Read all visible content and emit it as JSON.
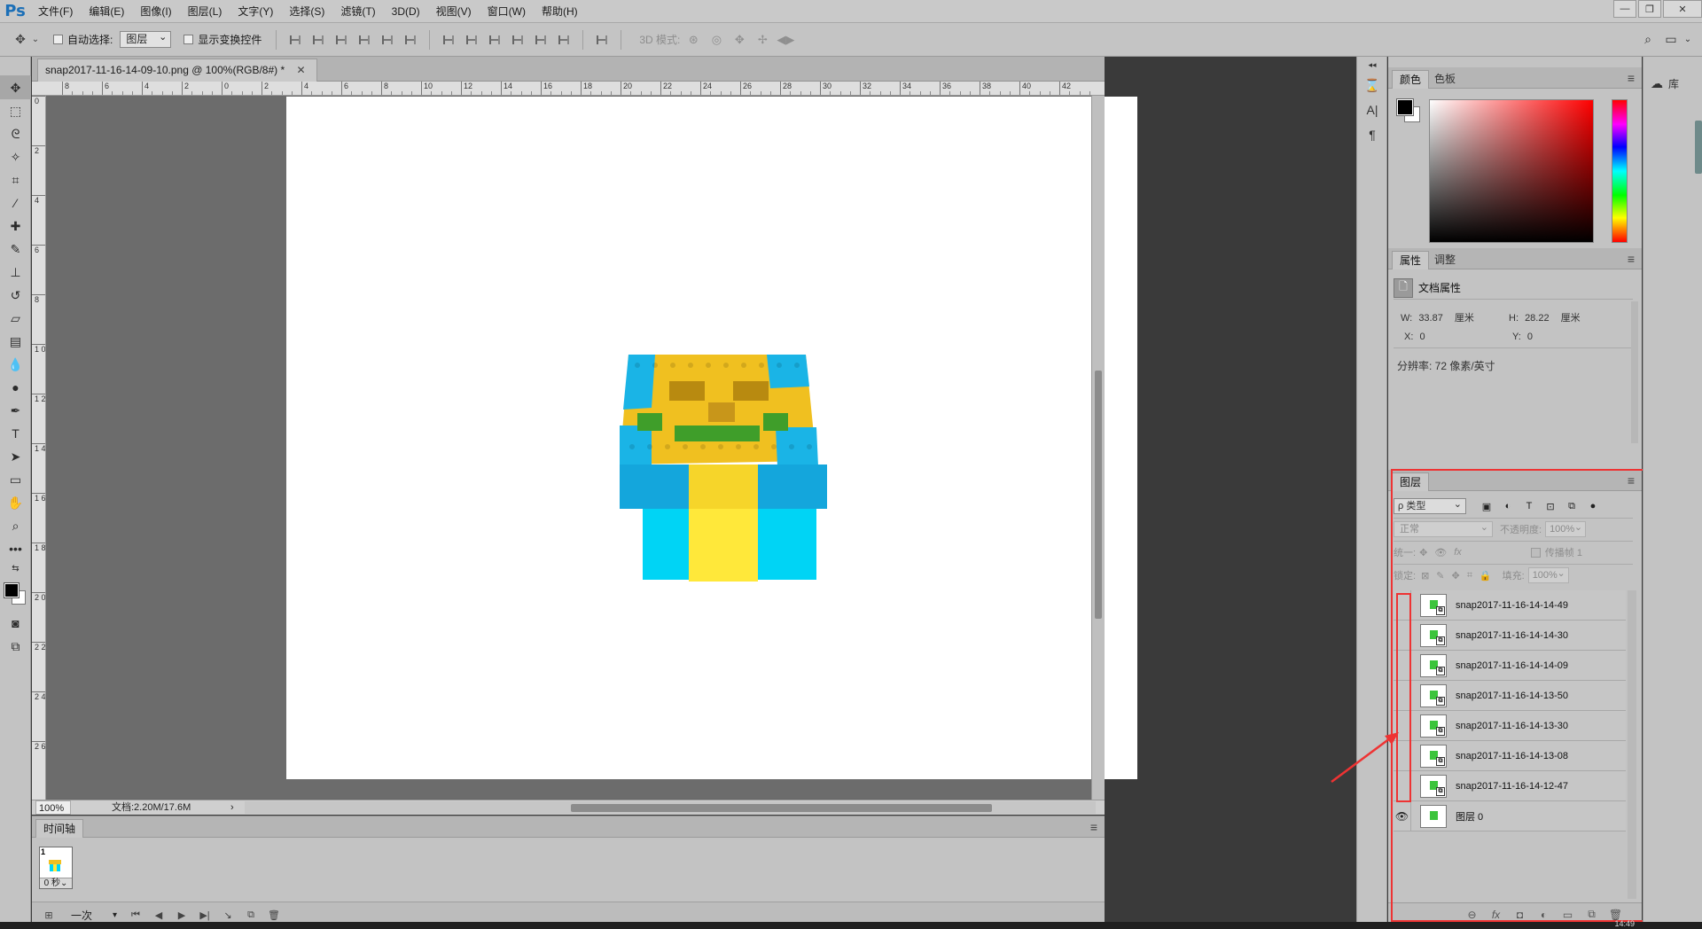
{
  "app": {
    "logo": "Ps"
  },
  "menu": [
    "文件(F)",
    "编辑(E)",
    "图像(I)",
    "图层(L)",
    "文字(Y)",
    "选择(S)",
    "滤镜(T)",
    "3D(D)",
    "视图(V)",
    "窗口(W)",
    "帮助(H)"
  ],
  "window_controls": [
    "—",
    "❐",
    "✕"
  ],
  "options_bar": {
    "auto_select_label": "自动选择:",
    "auto_select_value": "图层",
    "show_transform_label": "显示变换控件",
    "mode_3d_label": "3D 模式:"
  },
  "document": {
    "tab_title": "snap2017-11-16-14-09-10.png @ 100%(RGB/8#) *",
    "zoom": "100%",
    "info": "文档:2.20M/17.6M",
    "ruler_h": [
      "8",
      "6",
      "4",
      "2",
      "0",
      "2",
      "4",
      "6",
      "8",
      "10",
      "12",
      "14",
      "16",
      "18",
      "20",
      "22",
      "24",
      "26",
      "28",
      "30",
      "32",
      "34",
      "36",
      "38",
      "40",
      "42"
    ],
    "ruler_v": [
      "0",
      "2",
      "4",
      "6",
      "8",
      "1 0",
      "1 2",
      "1 4",
      "1 6",
      "1 8",
      "2 0",
      "2 2",
      "2 4",
      "2 6"
    ]
  },
  "timeline": {
    "tab": "时间轴",
    "frame_number": "1",
    "frame_delay": "0 秒",
    "loop": "一次"
  },
  "color_panel": {
    "tabs": [
      "颜色",
      "色板"
    ],
    "accent_red": "#ff0000",
    "foreground": "#000000",
    "background": "#ffffff"
  },
  "properties_panel": {
    "tabs": [
      "属性",
      "调整"
    ],
    "title": "文档属性",
    "w_label": "W:",
    "w_value": "33.87",
    "w_unit": "厘米",
    "h_label": "H:",
    "h_value": "28.22",
    "h_unit": "厘米",
    "x_label": "X:",
    "x_value": "0",
    "y_label": "Y:",
    "y_value": "0",
    "resolution": "分辨率: 72 像素/英寸"
  },
  "layers_panel": {
    "tab": "图层",
    "filter": "ρ 类型",
    "blend_mode": "正常",
    "opacity_label": "不透明度:",
    "opacity_value": "100%",
    "unify_label": "统一:",
    "propagate_label": "传播帧 1",
    "lock_label": "锁定:",
    "fill_label": "填充:",
    "fill_value": "100%",
    "layers": [
      {
        "name": "snap2017-11-16-14-14-49",
        "visible": false
      },
      {
        "name": "snap2017-11-16-14-14-30",
        "visible": false
      },
      {
        "name": "snap2017-11-16-14-14-09",
        "visible": false
      },
      {
        "name": "snap2017-11-16-14-13-50",
        "visible": false
      },
      {
        "name": "snap2017-11-16-14-13-30",
        "visible": false
      },
      {
        "name": "snap2017-11-16-14-13-08",
        "visible": false
      },
      {
        "name": "snap2017-11-16-14-12-47",
        "visible": false
      },
      {
        "name": "图层 0",
        "visible": true
      }
    ],
    "highlight_color": "#ee3333"
  },
  "library": {
    "label": "库"
  },
  "taskbar": {
    "time": "14:49"
  },
  "colors": {
    "lego_blue": "#1ab4e6",
    "lego_yellow": "#f0c020",
    "lego_green": "#3f9e2a",
    "ribbon_yellow": "#ffe83a",
    "ribbon_cyan": "#00d4f5"
  }
}
